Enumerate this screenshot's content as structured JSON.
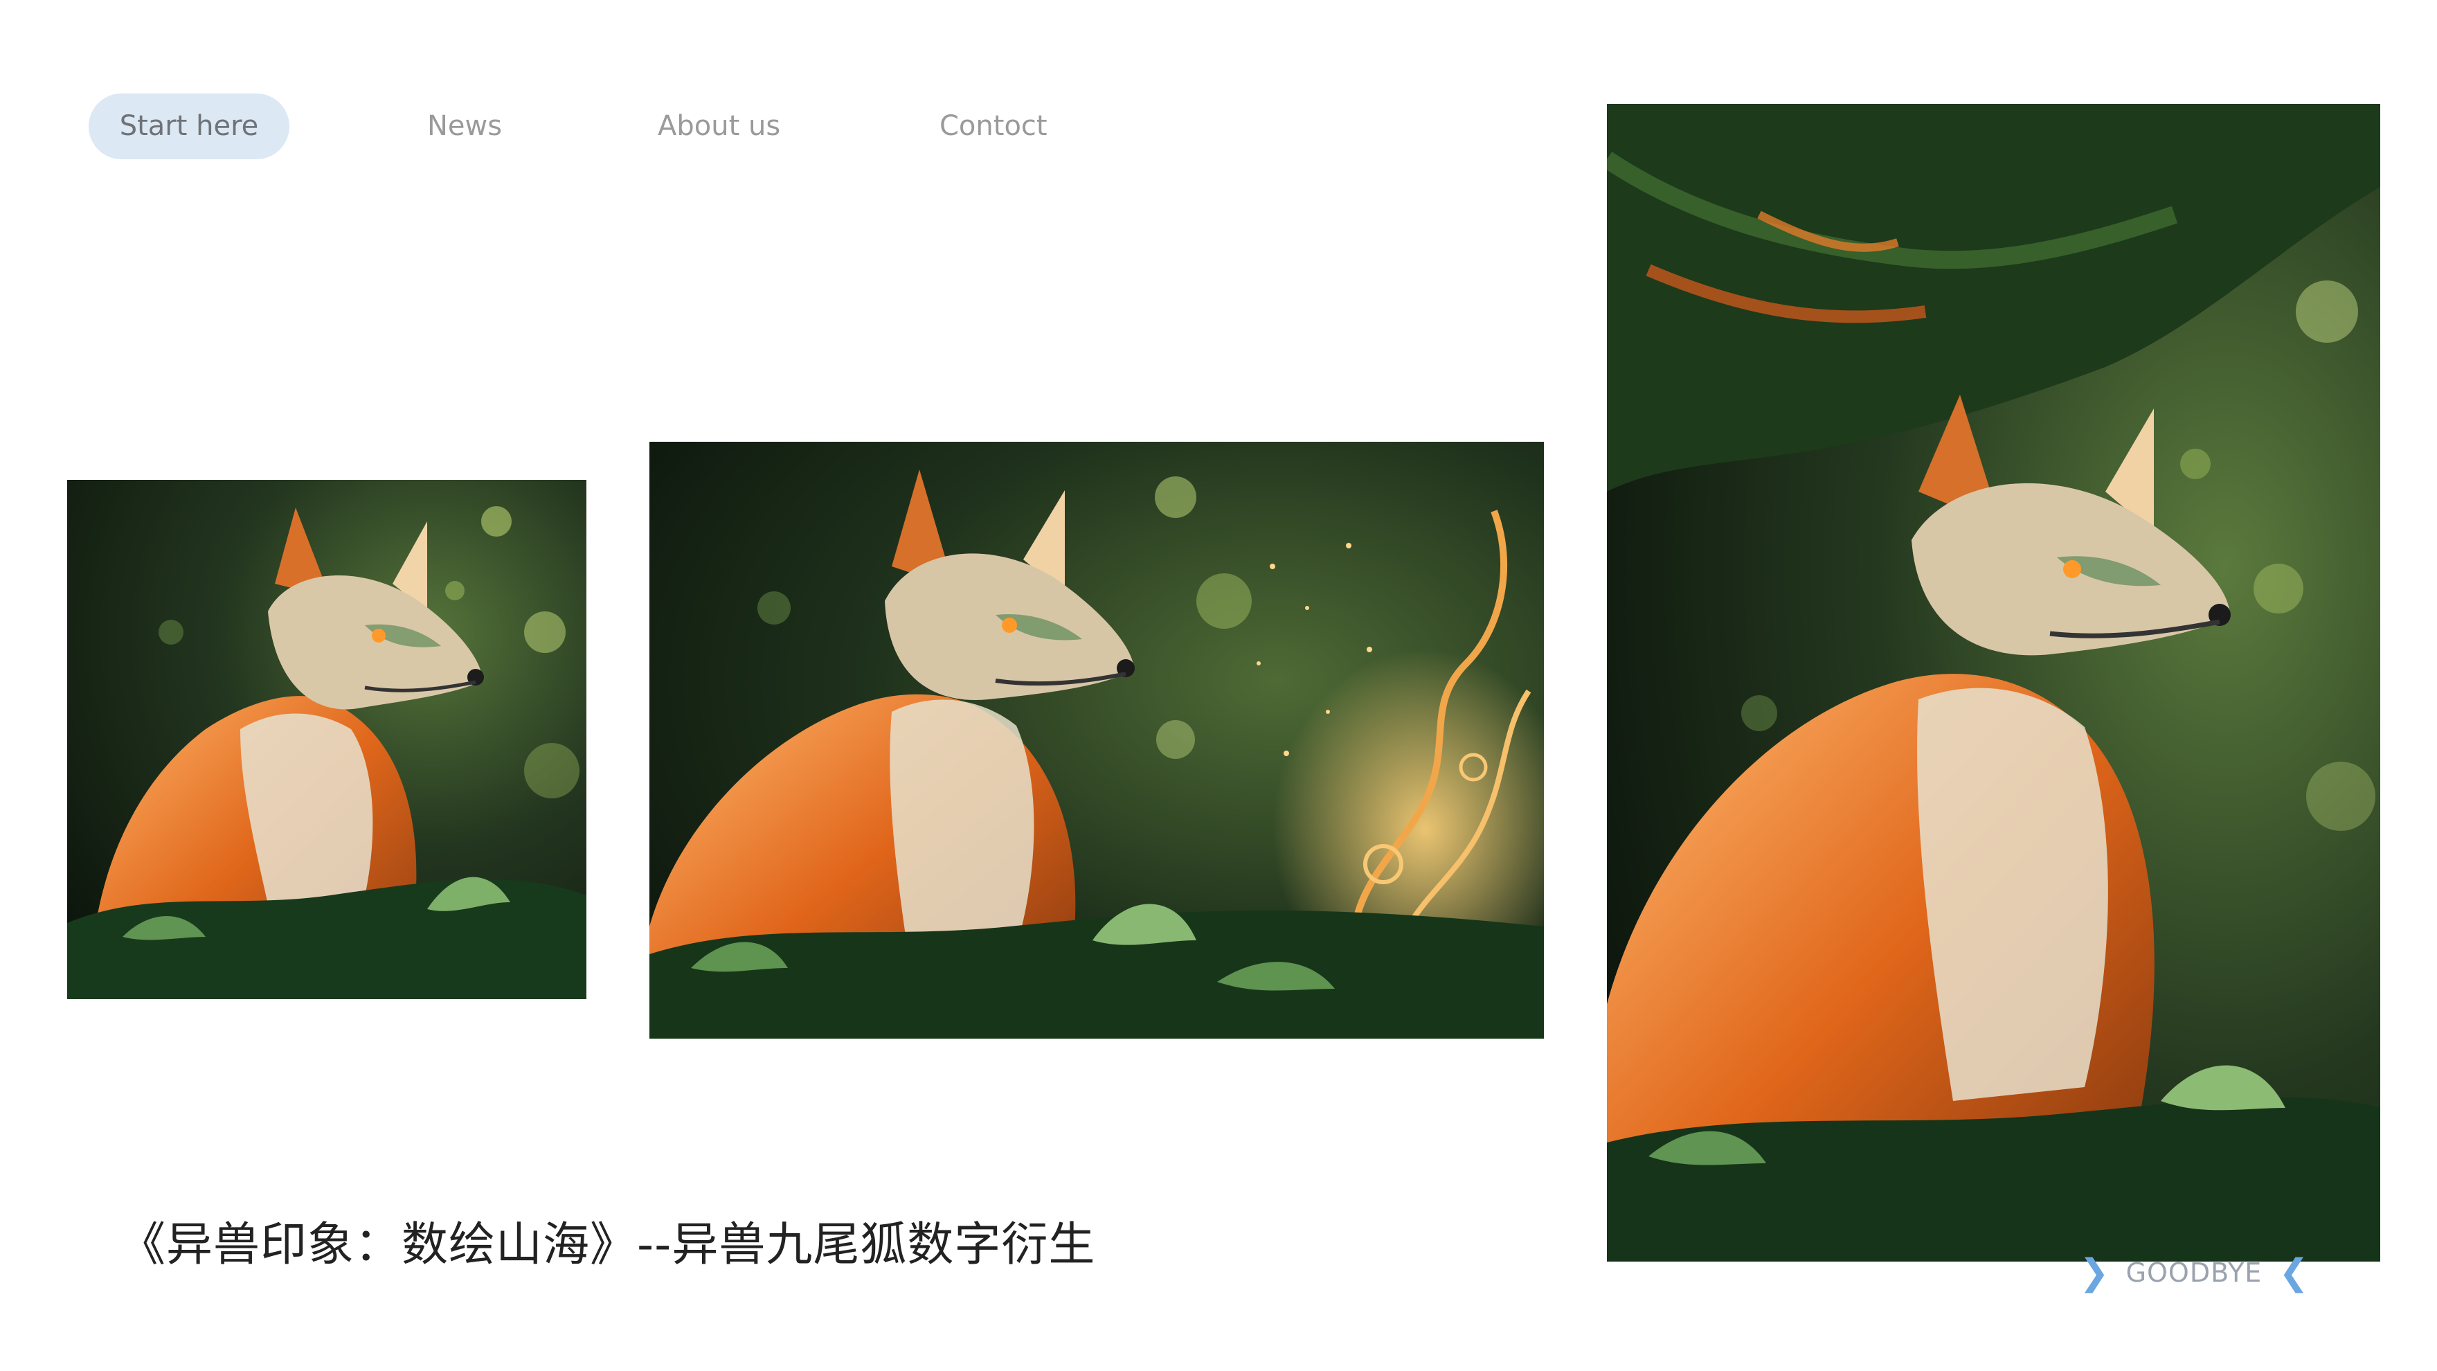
{
  "nav": {
    "items": [
      {
        "label": "Start here",
        "active": true
      },
      {
        "label": "News",
        "active": false
      },
      {
        "label": "About us",
        "active": false
      },
      {
        "label": "Contoct",
        "active": false
      }
    ]
  },
  "gallery": {
    "images": [
      {
        "subject": "nine-tailed fox in forest",
        "crop": "square"
      },
      {
        "subject": "nine-tailed fox with golden filigree",
        "crop": "landscape"
      },
      {
        "subject": "nine-tailed fox under tree canopy",
        "crop": "portrait"
      }
    ]
  },
  "caption": {
    "text": "《异兽印象：数绘山海》--异兽九尾狐数字衍生"
  },
  "footer": {
    "goodbye": "GOODBYE",
    "left_icon": "chevron-right-icon",
    "right_icon": "chevron-left-icon"
  },
  "colors": {
    "active_pill": "#dce8f3",
    "nav_text": "#9a9a9a",
    "caption_text": "#222222",
    "accent_chevron": "#6aa6e0"
  }
}
